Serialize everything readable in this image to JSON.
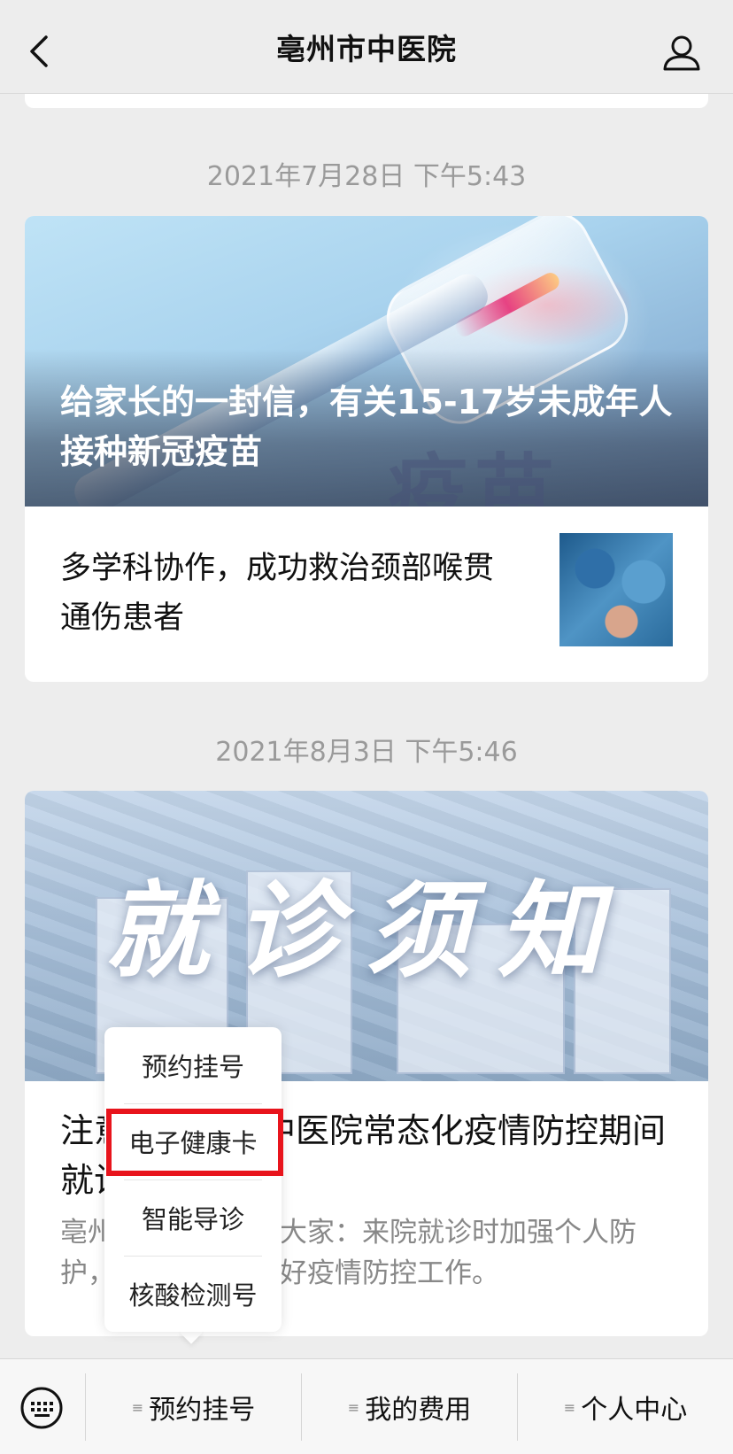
{
  "navbar": {
    "title": "亳州市中医院",
    "back_icon": "chevron-left-icon",
    "user_icon": "user-icon"
  },
  "messages": [
    {
      "timestamp": "2021年7月28日 下午5:43",
      "cover_title": "给家长的一封信，有关15-17岁未成年人接种新冠疫苗",
      "cover_watermark": "疫苗",
      "articles": [
        {
          "title": "多学科协作，成功救治颈部喉贯通伤患者"
        }
      ]
    },
    {
      "timestamp": "2021年8月3日 下午5:46",
      "cover_title": "就诊须知",
      "article_title": "注意！亳州市中医院常态化疫情防控期间就诊须知",
      "article_digest": "亳州市中医院提醒大家：来院就诊时加强个人防护，与医院共同做好疫情防控工作。"
    }
  ],
  "popup_menu": {
    "items": [
      "预约挂号",
      "电子健康卡",
      "智能导诊",
      "核酸检测号"
    ],
    "highlighted": "电子健康卡"
  },
  "bottom_bar": {
    "keyboard_icon": "keyboard-icon",
    "tabs": [
      {
        "label": "预约挂号"
      },
      {
        "label": "我的费用"
      },
      {
        "label": "个人中心"
      }
    ]
  },
  "colors": {
    "background": "#ededed",
    "highlight": "#e8141c"
  }
}
